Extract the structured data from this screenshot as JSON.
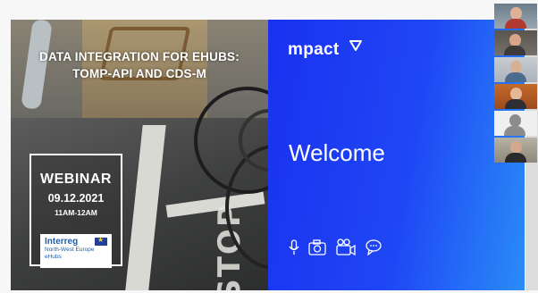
{
  "slide_left": {
    "title_line1": "DATA INTEGRATION FOR EHUBS:",
    "title_line2": "TOMP-API AND CDS-M",
    "webinar_label": "WEBINAR",
    "webinar_date": "09.12.2021",
    "webinar_time": "11AM-12AM",
    "partner_name": "Interreg",
    "partner_region": "North-West Europe",
    "partner_project": "eHubs"
  },
  "slide_right": {
    "brand": "mpact",
    "welcome": "Welcome",
    "icons": [
      "microphone-icon",
      "camera-icon",
      "video-camera-icon",
      "chat-bubbles-icon"
    ],
    "background_start": "#1a31f0",
    "background_end": "#2a8cf7"
  },
  "participants": [
    "participant-1",
    "participant-2",
    "participant-3",
    "participant-4",
    "participant-5",
    "participant-6"
  ]
}
